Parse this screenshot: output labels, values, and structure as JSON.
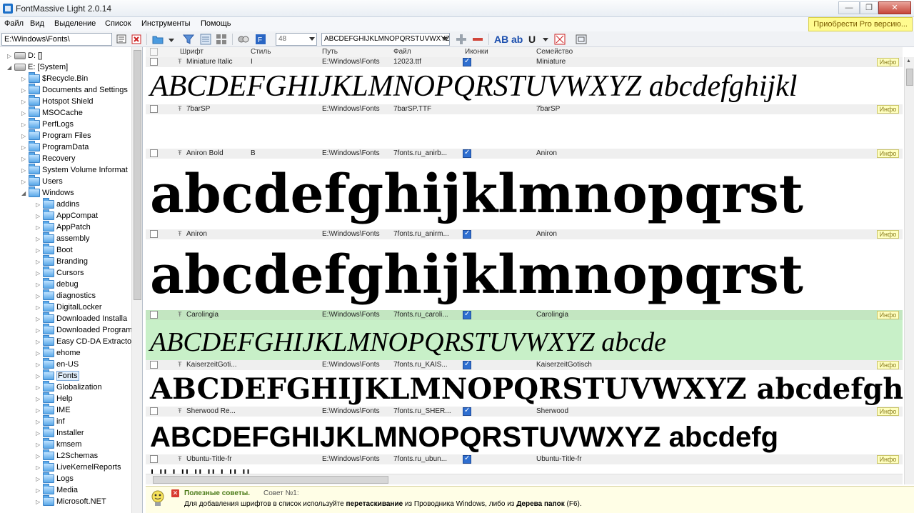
{
  "window": {
    "title": "FontMassive Light 2.0.14",
    "controls": [
      "—",
      "❐",
      "✕"
    ]
  },
  "menu": [
    "Файл",
    "Вид",
    "Выделение",
    "Список",
    "Инструменты",
    "Помощь"
  ],
  "pro_link": "Приобрести Pro версию...",
  "toolbar": {
    "path": "E:\\Windows\\Fonts\\",
    "size_value": "48",
    "sample_text": "ABCDEFGHIJKLMNOPQRSTUVWXYZ",
    "bold_label": "AB",
    "italic_label": "ab",
    "underline_label": "U"
  },
  "tree": {
    "items": [
      {
        "label": "D: []",
        "type": "drive",
        "level": 0
      },
      {
        "label": "E: [System]",
        "type": "drive",
        "level": 0,
        "expanded": true
      },
      {
        "label": "$Recycle.Bin",
        "level": 1
      },
      {
        "label": "Documents and Settings",
        "level": 1
      },
      {
        "label": "Hotspot Shield",
        "level": 1
      },
      {
        "label": "MSOCache",
        "level": 1
      },
      {
        "label": "PerfLogs",
        "level": 1
      },
      {
        "label": "Program Files",
        "level": 1
      },
      {
        "label": "ProgramData",
        "level": 1
      },
      {
        "label": "Recovery",
        "level": 1
      },
      {
        "label": "System Volume Informat",
        "level": 1
      },
      {
        "label": "Users",
        "level": 1
      },
      {
        "label": "Windows",
        "level": 1,
        "expanded": true
      },
      {
        "label": "addins",
        "level": 2
      },
      {
        "label": "AppCompat",
        "level": 2
      },
      {
        "label": "AppPatch",
        "level": 2
      },
      {
        "label": "assembly",
        "level": 2
      },
      {
        "label": "Boot",
        "level": 2
      },
      {
        "label": "Branding",
        "level": 2
      },
      {
        "label": "Cursors",
        "level": 2
      },
      {
        "label": "debug",
        "level": 2
      },
      {
        "label": "diagnostics",
        "level": 2
      },
      {
        "label": "DigitalLocker",
        "level": 2
      },
      {
        "label": "Downloaded Installa",
        "level": 2
      },
      {
        "label": "Downloaded Program",
        "level": 2
      },
      {
        "label": "Easy CD-DA Extracto",
        "level": 2
      },
      {
        "label": "ehome",
        "level": 2
      },
      {
        "label": "en-US",
        "level": 2
      },
      {
        "label": "Fonts",
        "level": 2,
        "selected": true
      },
      {
        "label": "Globalization",
        "level": 2
      },
      {
        "label": "Help",
        "level": 2
      },
      {
        "label": "IME",
        "level": 2
      },
      {
        "label": "inf",
        "level": 2
      },
      {
        "label": "Installer",
        "level": 2
      },
      {
        "label": "kmsem",
        "level": 2
      },
      {
        "label": "L2Schemas",
        "level": 2
      },
      {
        "label": "LiveKernelReports",
        "level": 2
      },
      {
        "label": "Logs",
        "level": 2
      },
      {
        "label": "Media",
        "level": 2
      },
      {
        "label": "Microsoft.NET",
        "level": 2
      }
    ]
  },
  "columns": [
    "Шрифт",
    "Стиль",
    "Путь",
    "Файл",
    "Иконки",
    "Семейство"
  ],
  "info_label": "Инфо",
  "fonts": [
    {
      "name": "Miniature Italic",
      "style": "I",
      "path": "E:\\Windows\\Fonts",
      "file": "12023.ttf",
      "icons": true,
      "family": "Miniature",
      "preview": "ABCDEFGHIJKLMNOPQRSTUVWXYZ abcdefghijkl"
    },
    {
      "name": "7barSP",
      "style": "",
      "path": "E:\\Windows\\Fonts",
      "file": "7barSP.TTF",
      "icons": false,
      "family": "7barSP",
      "preview": ""
    },
    {
      "name": "Aniron Bold",
      "style": "B",
      "path": "E:\\Windows\\Fonts",
      "file": "7fonts.ru_anirb...",
      "icons": true,
      "family": "Aniron",
      "preview": "abcdefghijklmnopqrst"
    },
    {
      "name": "Aniron",
      "style": "",
      "path": "E:\\Windows\\Fonts",
      "file": "7fonts.ru_anirm...",
      "icons": true,
      "family": "Aniron",
      "preview": "abcdefghijklmnopqrst"
    },
    {
      "name": "Carolingia",
      "style": "",
      "path": "E:\\Windows\\Fonts",
      "file": "7fonts.ru_caroli...",
      "icons": true,
      "family": "Carolingia",
      "preview": "ABCDEFGHIJKLMNOPQRSTUVWXYZ abcde"
    },
    {
      "name": "KaiserzeitGoti...",
      "style": "",
      "path": "E:\\Windows\\Fonts",
      "file": "7fonts.ru_KAIS...",
      "icons": true,
      "family": "KaiserzeitGotisch",
      "preview": "ABCDEFGHIJKLMNOPQRSTUVWXYZ abcdefghijkl"
    },
    {
      "name": "Sherwood Re...",
      "style": "",
      "path": "E:\\Windows\\Fonts",
      "file": "7fonts.ru_SHER...",
      "icons": true,
      "family": "Sherwood",
      "preview": "ABCDEFGHIJKLMNOPQRSTUVWXYZ abcdefg"
    },
    {
      "name": "Ubuntu-Title-fr",
      "style": "",
      "path": "E:\\Windows\\Fonts",
      "file": "7fonts.ru_ubun...",
      "icons": true,
      "family": "Ubuntu-Title-fr",
      "preview": "ı ıı ı ıı ıı ıı ı ıı ıı"
    }
  ],
  "tips": {
    "title": "Полезные советы.",
    "number": "Совет №1:",
    "text_a": "Для добавления шрифтов в список используйте ",
    "text_b": "перетаскивание",
    "text_c": " из Проводника Windows, либо из ",
    "text_d": "Дерева папок",
    "text_e": " (F6)."
  }
}
